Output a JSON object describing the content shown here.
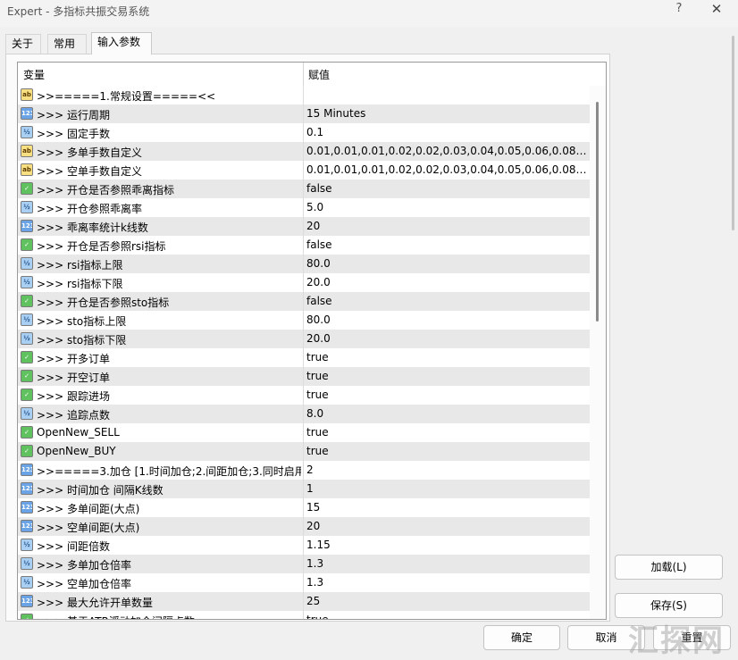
{
  "window": {
    "title": "Expert - 多指标共振交易系统",
    "help_label": "?",
    "close_label": "✕"
  },
  "tabs": [
    {
      "label": "关于",
      "active": false
    },
    {
      "label": "常用",
      "active": false
    },
    {
      "label": "输入参数",
      "active": true
    }
  ],
  "grid": {
    "header_variable": "变量",
    "header_value": "赋值",
    "rows": [
      {
        "icon": "ab",
        "name": ">>=====1.常规设置=====<<",
        "value": ""
      },
      {
        "icon": "int",
        "name": ">>>  运行周期",
        "value": "15 Minutes"
      },
      {
        "icon": "dbl",
        "name": ">>>  固定手数",
        "value": "0.1"
      },
      {
        "icon": "ab",
        "name": ">>>  多单手数自定义",
        "value": "0.01,0.01,0.01,0.02,0.02,0.03,0.04,0.05,0.06,0.08,0.11,0..."
      },
      {
        "icon": "ab",
        "name": ">>>  空单手数自定义",
        "value": "0.01,0.01,0.01,0.02,0.02,0.03,0.04,0.05,0.06,0.08,0.11,0..."
      },
      {
        "icon": "bool",
        "name": ">>>  开仓是否参照乖离指标",
        "value": "false"
      },
      {
        "icon": "dbl",
        "name": ">>>  开仓参照乖离率",
        "value": "5.0"
      },
      {
        "icon": "int",
        "name": ">>>  乖离率统计k线数",
        "value": "20"
      },
      {
        "icon": "bool",
        "name": ">>>  开仓是否参照rsi指标",
        "value": "false"
      },
      {
        "icon": "dbl",
        "name": ">>>  rsi指标上限",
        "value": "80.0"
      },
      {
        "icon": "dbl",
        "name": ">>>  rsi指标下限",
        "value": "20.0"
      },
      {
        "icon": "bool",
        "name": ">>>  开仓是否参照sto指标",
        "value": "false"
      },
      {
        "icon": "dbl",
        "name": ">>>  sto指标上限",
        "value": "80.0"
      },
      {
        "icon": "dbl",
        "name": ">>>  sto指标下限",
        "value": "20.0"
      },
      {
        "icon": "bool",
        "name": ">>>  开多订单",
        "value": "true"
      },
      {
        "icon": "bool",
        "name": ">>>  开空订单",
        "value": "true"
      },
      {
        "icon": "bool",
        "name": ">>>  跟踪进场",
        "value": "true"
      },
      {
        "icon": "dbl",
        "name": ">>>  追踪点数",
        "value": "8.0"
      },
      {
        "icon": "bool",
        "name": "OpenNew_SELL",
        "value": "true"
      },
      {
        "icon": "bool",
        "name": "OpenNew_BUY",
        "value": "true"
      },
      {
        "icon": "int",
        "name": ">>=====3.加仓 [1.时间加仓;2.间距加仓;3.同时启用...",
        "value": "2"
      },
      {
        "icon": "int",
        "name": ">>>  时间加仓 间隔K线数",
        "value": "1"
      },
      {
        "icon": "int",
        "name": ">>>  多单间距(大点)",
        "value": "15"
      },
      {
        "icon": "int",
        "name": ">>>  空单间距(大点)",
        "value": "20"
      },
      {
        "icon": "dbl",
        "name": ">>>  间距倍数",
        "value": "1.15"
      },
      {
        "icon": "dbl",
        "name": ">>>  多单加仓倍率",
        "value": "1.3"
      },
      {
        "icon": "dbl",
        "name": ">>>  空单加仓倍率",
        "value": "1.3"
      },
      {
        "icon": "int",
        "name": ">>>  最大允许开单数量",
        "value": "25"
      },
      {
        "icon": "bool",
        "name": ">>>  基于ATR浮动加仓间隔点数",
        "value": "true"
      }
    ]
  },
  "buttons": {
    "load": "加载(L)",
    "save": "保存(S)",
    "ok": "确定",
    "cancel": "取消",
    "reset": "重置"
  },
  "watermark": "汇探网",
  "icon_glyphs": {
    "ab": "ab",
    "int": "123",
    "dbl": "½",
    "bool": "✓"
  }
}
